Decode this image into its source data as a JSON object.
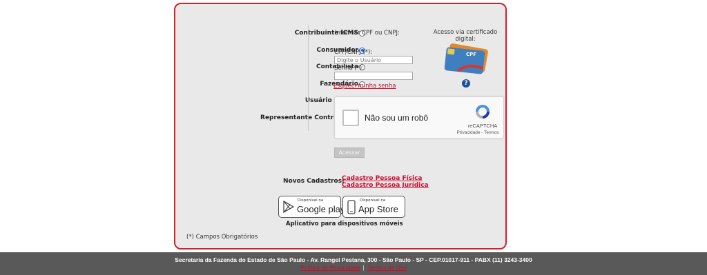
{
  "login_types": [
    {
      "label": "Contribuinte ICMS",
      "checked": false
    },
    {
      "label": "Consumidor",
      "checked": true
    },
    {
      "label": "Contabilista",
      "checked": false
    },
    {
      "label": "Fazendário",
      "checked": false
    },
    {
      "label": "Usuário Procon",
      "checked": false
    },
    {
      "label": "Representante Contribuinte",
      "checked": false
    }
  ],
  "form": {
    "heading": "Informar CPF ou CNPJ:",
    "cpf_label": "CPF/CNPJ (*):",
    "cpf_placeholder": "Digite o Usuário",
    "senha_label": "Senha (*):",
    "forgot_link": "Esqueci minha senha",
    "submit_label": "Acessar"
  },
  "certificate": {
    "text": "Acesso via certificado digital:",
    "card_label": "CPF",
    "help": "?"
  },
  "recaptcha": {
    "label": "Não sou um robô",
    "brand": "reCAPTCHA",
    "terms": "Privacidade - Termos"
  },
  "cadastros": {
    "label": "Novos Cadastros:",
    "pessoa_fisica": "Cadastro Pessoa Física",
    "pessoa_juridica": "Cadastro Pessoa Jurídica"
  },
  "apps": {
    "google_small": "Disponível na",
    "google_big": "Google play",
    "apple_small": "Disponível na",
    "apple_big": "App Store",
    "caption": "Aplicativo para dispositivos móveis"
  },
  "required_note": "(*) Campos Obrigatórios",
  "footer": {
    "address": "Secretaria da Fazenda do Estado de São Paulo - Av. Rangel Pestana, 300 - São Paulo - SP - CEP.01017-911 - PABX (11) 3243-3400",
    "privacy_link": "Política de Privacidade",
    "separator": "|",
    "terms_link": "Termos de Uso"
  },
  "colors": {
    "accent": "#d51f28",
    "link": "#c8102e",
    "panel_bg": "#e9e9e9",
    "footer_bg": "#595959"
  }
}
